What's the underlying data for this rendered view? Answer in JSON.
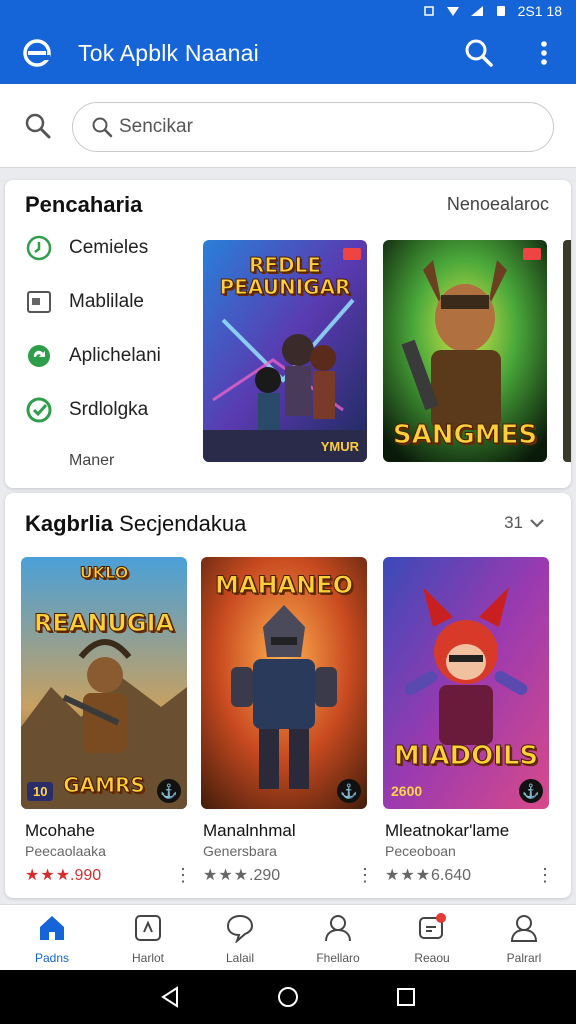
{
  "status": {
    "time": "2S1 18"
  },
  "appbar": {
    "title": "Tok Apblk Naanai",
    "logo_icon": "e-logo-icon",
    "accent": "#1565d8"
  },
  "search": {
    "placeholder": "Sencikar"
  },
  "section1": {
    "title": "Pencaharia",
    "link": "Nenoealaroc",
    "menu": [
      {
        "label": "Cemieles",
        "icon": "clock-icon"
      },
      {
        "label": "Mablilale",
        "icon": "folder-icon"
      },
      {
        "label": "Aplichelani",
        "icon": "refresh-icon"
      },
      {
        "label": "Srdlolgka",
        "icon": "check-circle-icon"
      }
    ],
    "more": "Maner",
    "banners": [
      {
        "caption": "REDLE PEAUNIGAR",
        "tag": "YMUR"
      },
      {
        "caption": "SANGMES"
      }
    ]
  },
  "section2": {
    "title_bold": "Kagbrlia",
    "title_rest": "Secjendakua",
    "more": "31",
    "games": [
      {
        "cover_top": "UKLO",
        "cover_title": "REANUGIA",
        "cover_bottom": "GAMRS",
        "badge": "10",
        "name": "Mcohahe",
        "sub": "Peecaolaaka",
        "stars": "★★",
        "rating": "★.990",
        "rating_color": "#d32f2f"
      },
      {
        "cover_title": "MAHANEO",
        "name": "Manalnhmal",
        "sub": "Genersbara",
        "stars": "★★★",
        "rating": ".290",
        "rating_color": "#666666"
      },
      {
        "cover_title": "MIADOILS",
        "badge": "2600",
        "name": "Mleatnokar'lame",
        "sub": "Peceoboan",
        "stars": "★★★",
        "rating": "6.640",
        "rating_color": "#666666"
      }
    ]
  },
  "bottomnav": [
    {
      "label": "Padns",
      "icon": "home-icon",
      "active": true
    },
    {
      "label": "Harlot",
      "icon": "apps-icon"
    },
    {
      "label": "Lalail",
      "icon": "chat-icon"
    },
    {
      "label": "Fhellaro",
      "icon": "person-icon"
    },
    {
      "label": "Reaou",
      "icon": "notification-icon"
    },
    {
      "label": "Palrarl",
      "icon": "account-icon"
    }
  ]
}
